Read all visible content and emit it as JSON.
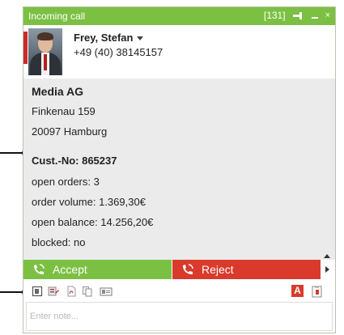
{
  "window": {
    "title": "Incoming call",
    "counter": "[131]"
  },
  "caller": {
    "name": "Frey, Stefan",
    "phone": "+49 (40) 38145157"
  },
  "company": {
    "name": "Media AG",
    "street": "Finkenau 159",
    "city": "20097 Hamburg"
  },
  "customer": {
    "number": "Cust.-No: 865237",
    "open_orders": "open orders: 3",
    "order_volume": "order volume: 1.369,30€",
    "open_balance": "open balance: 14.256,20€",
    "blocked": "blocked: no"
  },
  "actions": {
    "accept_label": "Accept",
    "reject_label": "Reject"
  },
  "toolbar": {
    "icons": [
      "contact-card-icon",
      "contact-edit-icon",
      "pdf-document-icon",
      "copy-document-icon",
      "id-card-icon",
      "red-a-icon",
      "clipboard-icon"
    ],
    "red_a_label": "A"
  },
  "note": {
    "placeholder": "Enter note..."
  },
  "colors": {
    "accent_green": "#7cc043",
    "reject_red": "#d93a2b",
    "panel_gray": "#ebebeb"
  }
}
